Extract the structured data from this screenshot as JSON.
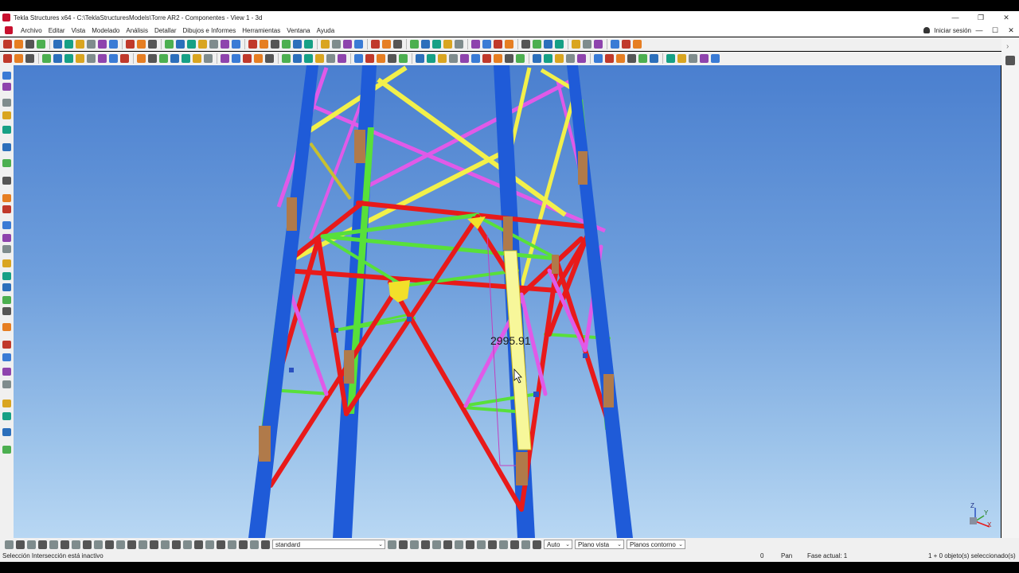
{
  "window": {
    "title": "Tekla Structures x64 - C:\\TeklaStructuresModels\\Torre AR2 - Componentes - View 1 - 3d",
    "controls": [
      "—",
      "❐",
      "✕"
    ]
  },
  "menu": {
    "items": [
      "Archivo",
      "Editar",
      "Vista",
      "Modelado",
      "Análisis",
      "Detallar",
      "Dibujos e Informes",
      "Herramientas",
      "Ventana",
      "Ayuda"
    ],
    "login": "Iniciar sesión",
    "controls": [
      "—",
      "☐",
      "✕"
    ]
  },
  "right_panel": {
    "chevron": "›"
  },
  "viewport": {
    "dimension_label": "2995.91",
    "axis_labels": [
      "Z",
      "X",
      "Y"
    ]
  },
  "bottom_toolbar": {
    "view_filter": "standard",
    "snap_mode": "Auto",
    "plane_mode": "Plano vista",
    "contour_mode": "Planos contorno"
  },
  "status": {
    "message": "Selección Intersección está inactivo",
    "count": "0",
    "mode": "Pan",
    "phase": "Fase actual: 1",
    "selection": "1 + 0 objeto(s) seleccionado(s)"
  },
  "colors": {
    "sky_top": "#4a7fcf",
    "sky_bottom": "#b8d7f3",
    "column": "#1f5bd8",
    "horizontal_member": "#e81a1a",
    "diagonal_green": "#58e03a",
    "brace_magenta": "#e05ae8",
    "brace_yellow": "#f2f04a",
    "plate": "#b07a4a"
  }
}
